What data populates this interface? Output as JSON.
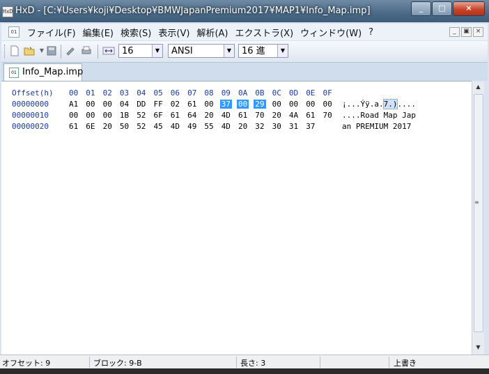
{
  "window": {
    "title": "HxD - [C:¥Users¥koji¥Desktop¥BMWJapanPremium2017¥MAP1¥Info_Map.imp]",
    "app_icon": "HxD",
    "buttons": {
      "minimize": "_",
      "maximize": "□",
      "close": "×"
    }
  },
  "menu": {
    "items": [
      "ファイル(F)",
      "編集(E)",
      "検索(S)",
      "表示(V)",
      "解析(A)",
      "エクストラ(X)",
      "ウィンドウ(W)",
      "?"
    ],
    "mdi_buttons": [
      "_",
      "▣",
      "×"
    ]
  },
  "toolbar": {
    "icons": [
      "new-file-icon",
      "open-folder-icon",
      "save-icon",
      "wrench-icon",
      "print-icon",
      "columns-icon"
    ],
    "bytes_per_row": "16",
    "charset": "ANSI",
    "offset_base": "16 進"
  },
  "tab": {
    "label": "Info_Map.imp"
  },
  "editor": {
    "header_offset": "Offset(h)",
    "header_cols": [
      "00",
      "01",
      "02",
      "03",
      "04",
      "05",
      "06",
      "07",
      "08",
      "09",
      "0A",
      "0B",
      "0C",
      "0D",
      "0E",
      "0F"
    ],
    "rows": [
      {
        "offset": "00000000",
        "bytes": [
          "A1",
          "00",
          "00",
          "04",
          "DD",
          "FF",
          "02",
          "61",
          "00",
          "37",
          "00",
          "29",
          "00",
          "00",
          "00",
          "00"
        ],
        "ascii_pre": "¡...Ýÿ.a.",
        "ascii_sel": "7.)",
        "ascii_post": "...."
      },
      {
        "offset": "00000010",
        "bytes": [
          "00",
          "00",
          "00",
          "1B",
          "52",
          "6F",
          "61",
          "64",
          "20",
          "4D",
          "61",
          "70",
          "20",
          "4A",
          "61",
          "70"
        ],
        "ascii_pre": "....Road Map Jap",
        "ascii_sel": "",
        "ascii_post": ""
      },
      {
        "offset": "00000020",
        "bytes": [
          "61",
          "6E",
          "20",
          "50",
          "52",
          "45",
          "4D",
          "49",
          "55",
          "4D",
          "20",
          "32",
          "30",
          "31",
          "37"
        ],
        "ascii_pre": "an PREMIUM 2017",
        "ascii_sel": "",
        "ascii_post": ""
      }
    ],
    "selected_hex": "37 00 29"
  },
  "status": {
    "offset": "オフセット: 9",
    "block": "ブロック: 9-B",
    "length": "長さ: 3",
    "mode": "上書き"
  }
}
